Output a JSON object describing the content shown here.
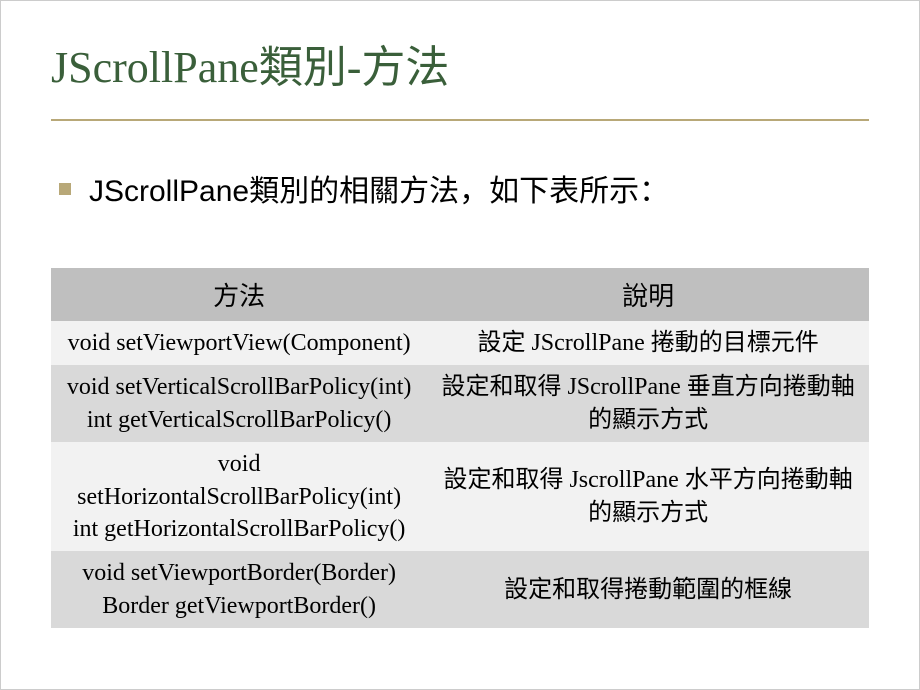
{
  "title": "JScrollPane類別-方法",
  "bullet_prefix": "JScrollPane",
  "bullet_suffix": "類別的相關方法，如下表所示：",
  "table": {
    "headers": [
      "方法",
      "說明"
    ],
    "rows": [
      {
        "method": "void setViewportView(Component)",
        "desc": "設定 JScrollPane 捲動的目標元件"
      },
      {
        "method": "void setVerticalScrollBarPolicy(int)\nint getVerticalScrollBarPolicy()",
        "desc": "設定和取得 JScrollPane 垂直方向捲動軸的顯示方式"
      },
      {
        "method": "void setHorizontalScrollBarPolicy(int)\nint getHorizontalScrollBarPolicy()",
        "desc": "設定和取得 JscrollPane 水平方向捲動軸的顯示方式"
      },
      {
        "method": "void setViewportBorder(Border)\nBorder getViewportBorder()",
        "desc": "設定和取得捲動範圍的框線"
      }
    ]
  }
}
